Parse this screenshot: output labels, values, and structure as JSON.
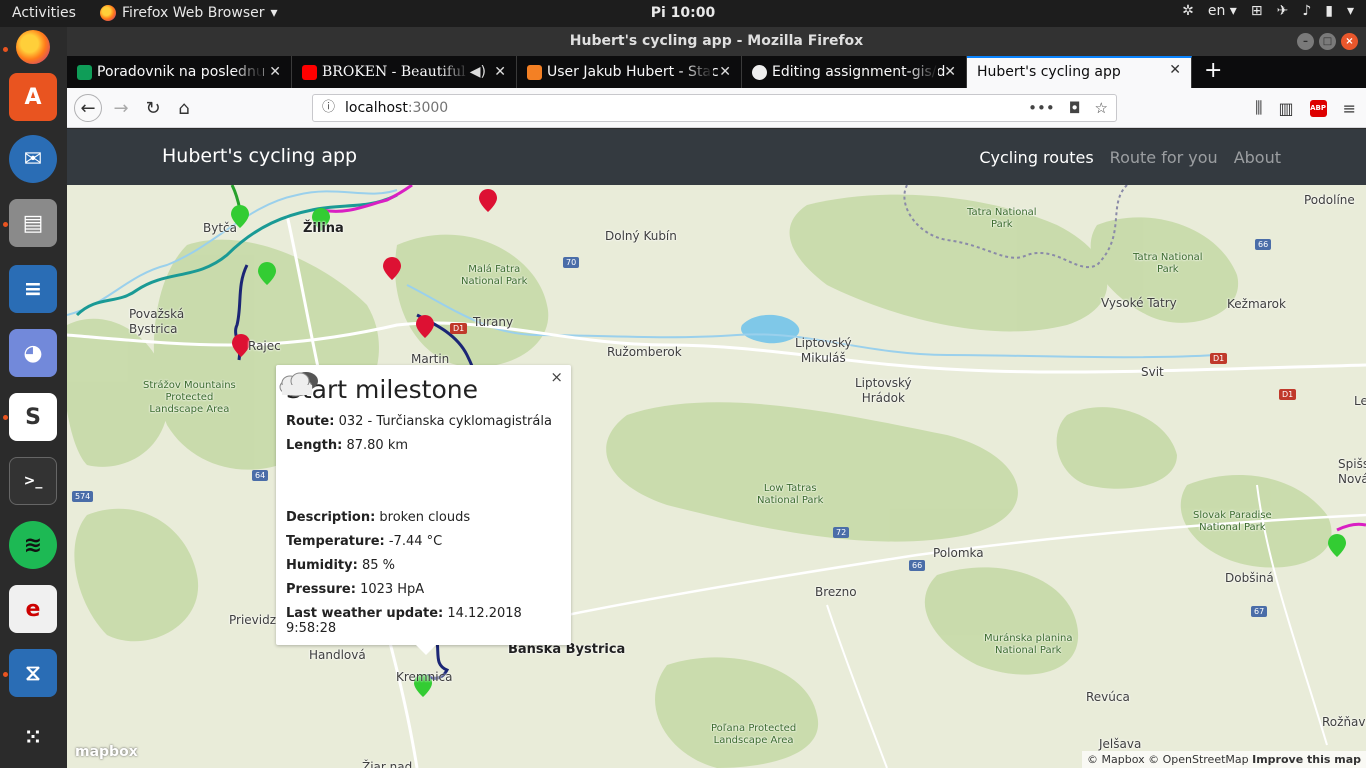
{
  "system": {
    "activities": "Activities",
    "app_menu": "Firefox Web Browser",
    "clock": "Pi 10:00",
    "language": "en"
  },
  "window": {
    "title": "Hubert's cycling app - Mozilla Firefox"
  },
  "tabs": [
    {
      "label": "Poradovnik na poslednu",
      "icon_color": "#0f9d58"
    },
    {
      "label": "BROKEN - Beautiful",
      "icon_color": "#ff0000"
    },
    {
      "label": "User Jakub Hubert - Stac",
      "icon_color": "#f48024"
    },
    {
      "label": "Editing assignment-gis/d",
      "icon_color": "#24292e"
    },
    {
      "label": "Hubert's cycling app",
      "icon_color": "#ffffff"
    }
  ],
  "url": {
    "host": "localhost",
    "port": ":3000"
  },
  "app": {
    "brand": "Hubert's cycling app",
    "nav": {
      "routes": "Cycling routes",
      "route_for_you": "Route for you",
      "about": "About"
    }
  },
  "popup": {
    "title": "Start milestone",
    "close": "×",
    "route_label": "Route:",
    "route_value": "032 - Turčianska cyklomagistrála",
    "length_label": "Length:",
    "length_value": "87.80 km",
    "description_label": "Description:",
    "description_value": "broken clouds",
    "temperature_label": "Temperature:",
    "temperature_value": "-7.44 °C",
    "humidity_label": "Humidity:",
    "humidity_value": "85 %",
    "pressure_label": "Pressure:",
    "pressure_value": "1023 HpA",
    "update_label": "Last weather update:",
    "update_value": "14.12.2018 9:58:28"
  },
  "map": {
    "places": {
      "bytca": "Bytča",
      "zilina": "Žilina",
      "dolny_kubin": "Dolný Kubín",
      "povazska": "Považská\nBystrica",
      "rajec": "Rajec",
      "turany": "Turany",
      "martin": "Martin",
      "ruzomberok": "Ružomberok",
      "liptovsky_mikulas": "Liptovský\nMikuláš",
      "liptovsky_hradok": "Liptovský\nHrádok",
      "svit": "Svit",
      "vysoke_tatry": "Vysoké Tatry",
      "kezmarok": "Kežmarok",
      "podoline": "Podolíne",
      "le": "Le",
      "spisska": "Spišs\nNová",
      "polomka": "Polomka",
      "brezno": "Brezno",
      "dobsina": "Dobšiná",
      "prievidza": "Prievidz",
      "handlova": "Handlová",
      "banska_bystrica": "Banská Bystrica",
      "kremnica": "Kremnica",
      "revuca": "Revúca",
      "roznava": "Rožňava",
      "jelsava": "Jelšava",
      "ziar": "Žiar nad"
    },
    "parks": {
      "tatra": "Tatra National\nPark",
      "tatra2": "Tatra National\nPark",
      "mala_fatra": "Malá Fatra\nNational Park",
      "strazov": "Strážov Mountains\nProtected\nLandscape Area",
      "low_tatras": "Low Tatras\nNational Park",
      "slovak_paradise": "Slovak Paradise\nNational Park",
      "muranska": "Muránska planina\nNational Park",
      "polana": "Poľana Protected\nLandscape Area"
    },
    "shields": {
      "r70": "70",
      "r66a": "66",
      "d1a": "D1",
      "d1b": "D1",
      "d1c": "D1",
      "r64": "64",
      "r574": "574",
      "r72": "72",
      "r66b": "66",
      "r67": "67"
    },
    "attribution": "© Mapbox © OpenStreetMap",
    "improve": "Improve this map",
    "logo": "mapbox"
  }
}
